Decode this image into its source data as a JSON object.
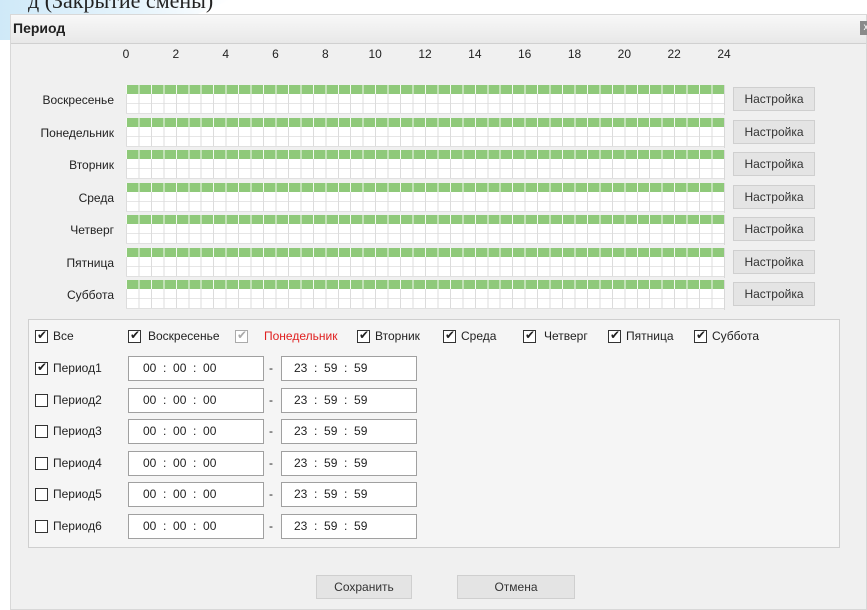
{
  "background_title": "д (Закрытие смены)",
  "dialog": {
    "title": "Период",
    "close_label": "x"
  },
  "hours": [
    "0",
    "2",
    "4",
    "6",
    "8",
    "10",
    "12",
    "14",
    "16",
    "18",
    "20",
    "22",
    "24"
  ],
  "days": [
    {
      "label": "Воскресенье",
      "button": "Настройка"
    },
    {
      "label": "Понедельник",
      "button": "Настройка"
    },
    {
      "label": "Вторник",
      "button": "Настройка"
    },
    {
      "label": "Среда",
      "button": "Настройка"
    },
    {
      "label": "Четверг",
      "button": "Настройка"
    },
    {
      "label": "Пятница",
      "button": "Настройка"
    },
    {
      "label": "Суббота",
      "button": "Настройка"
    }
  ],
  "day_checks": [
    {
      "label": "Все",
      "checked": true
    },
    {
      "label": "Воскресенье",
      "checked": true
    },
    {
      "label": "Понедельник",
      "checked": true,
      "current": true
    },
    {
      "label": "Вторник",
      "checked": true
    },
    {
      "label": "Среда",
      "checked": true
    },
    {
      "label": "Четверг",
      "checked": true
    },
    {
      "label": "Пятница",
      "checked": true
    },
    {
      "label": "Суббота",
      "checked": true
    }
  ],
  "periods": [
    {
      "label": "Период1",
      "checked": true,
      "start": "00  :  00  :  00",
      "end": "23  :  59  :  59"
    },
    {
      "label": "Период2",
      "checked": false,
      "start": "00  :  00  :  00",
      "end": "23  :  59  :  59"
    },
    {
      "label": "Период3",
      "checked": false,
      "start": "00  :  00  :  00",
      "end": "23  :  59  :  59"
    },
    {
      "label": "Период4",
      "checked": false,
      "start": "00  :  00  :  00",
      "end": "23  :  59  :  59"
    },
    {
      "label": "Период5",
      "checked": false,
      "start": "00  :  00  :  00",
      "end": "23  :  59  :  59"
    },
    {
      "label": "Период6",
      "checked": false,
      "start": "00  :  00  :  00",
      "end": "23  :  59  :  59"
    }
  ],
  "period_separator": "-",
  "footer": {
    "save_label": "Сохранить",
    "cancel_label": "Отмена"
  },
  "colors": {
    "schedule_fill": "#8fc97a",
    "current_day": "#e02020"
  }
}
